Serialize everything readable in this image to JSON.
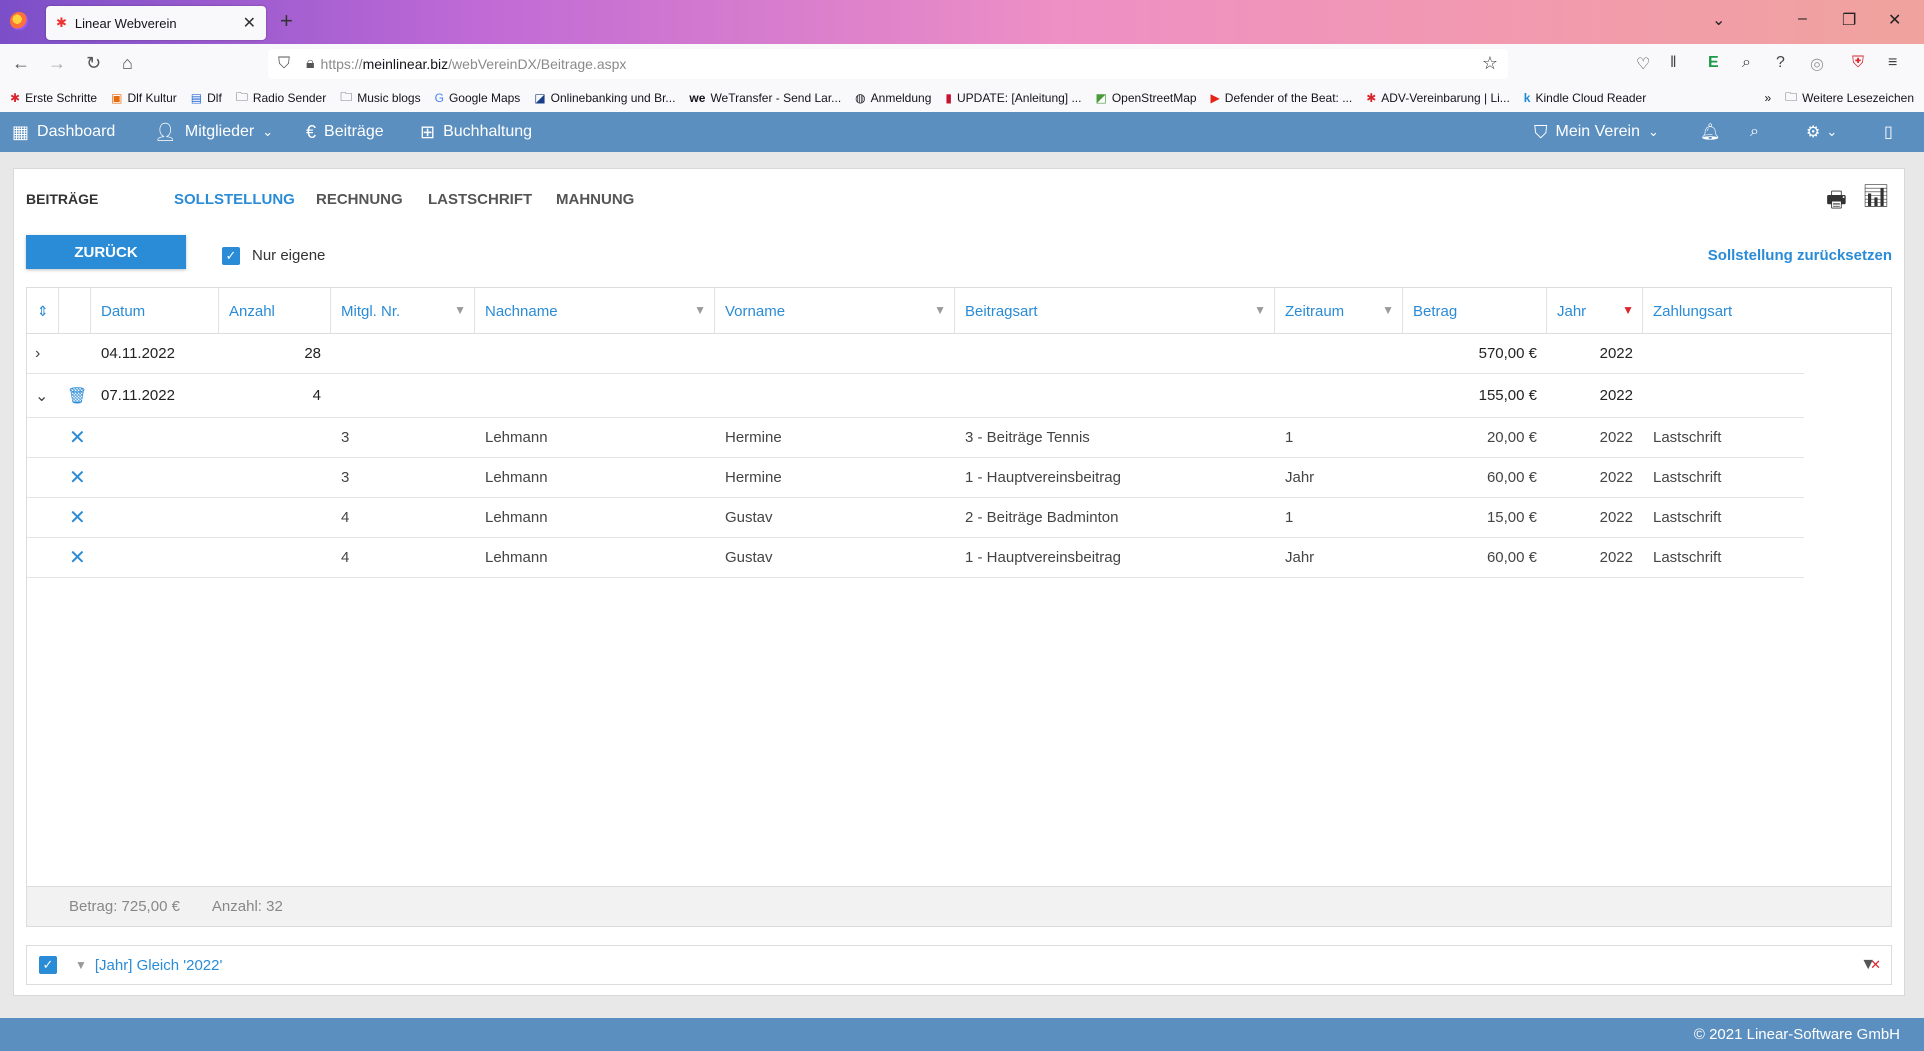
{
  "browser": {
    "tab_title": "Linear Webverein",
    "url_prefix": "https://",
    "url_host": "meinlinear.biz",
    "url_path": "/webVereinDX/Beitrage.aspx",
    "bookmarks": [
      "Erste Schritte",
      "Dlf Kultur",
      "Dlf",
      "Radio Sender",
      "Music blogs",
      "Google Maps",
      "Onlinebanking und Br...",
      "WeTransfer - Send Lar...",
      "Anmeldung",
      "UPDATE: [Anleitung] ...",
      "OpenStreetMap",
      "Defender of the Beat: ...",
      "ADV-Vereinbarung | Li...",
      "Kindle Cloud Reader"
    ],
    "bookmarks_more": "Weitere Lesezeichen"
  },
  "header": {
    "dashboard": "Dashboard",
    "mitglieder": "Mitglieder",
    "beitraege": "Beiträge",
    "buchhaltung": "Buchhaltung",
    "verein": "Mein Verein"
  },
  "page": {
    "title": "BEITRÄGE",
    "tabs": [
      "SOLLSTELLUNG",
      "RECHNUNG",
      "LASTSCHRIFT",
      "MAHNUNG"
    ],
    "back_button": "ZURÜCK",
    "own_only_label": "Nur eigene",
    "reset_link": "Sollstellung zurücksetzen"
  },
  "grid": {
    "columns": [
      "Datum",
      "Anzahl",
      "Mitgl. Nr.",
      "Nachname",
      "Vorname",
      "Beitragsart",
      "Zeitraum",
      "Betrag",
      "Jahr",
      "Zahlungsart"
    ],
    "groups": [
      {
        "datum": "04.11.2022",
        "anzahl": "28",
        "betrag": "570,00 €",
        "jahr": "2022"
      },
      {
        "datum": "07.11.2022",
        "anzahl": "4",
        "betrag": "155,00 €",
        "jahr": "2022"
      }
    ],
    "rows": [
      {
        "nr": "3",
        "nachname": "Lehmann",
        "vorname": "Hermine",
        "beitragsart": "3 - Beiträge Tennis",
        "zeitraum": "1",
        "betrag": "20,00 €",
        "jahr": "2022",
        "zahlungsart": "Lastschrift"
      },
      {
        "nr": "3",
        "nachname": "Lehmann",
        "vorname": "Hermine",
        "beitragsart": "1 - Hauptvereinsbeitrag",
        "zeitraum": "Jahr",
        "betrag": "60,00 €",
        "jahr": "2022",
        "zahlungsart": "Lastschrift"
      },
      {
        "nr": "4",
        "nachname": "Lehmann",
        "vorname": "Gustav",
        "beitragsart": "2 - Beiträge Badminton",
        "zeitraum": "1",
        "betrag": "15,00 €",
        "jahr": "2022",
        "zahlungsart": "Lastschrift"
      },
      {
        "nr": "4",
        "nachname": "Lehmann",
        "vorname": "Gustav",
        "beitragsart": "1 - Hauptvereinsbeitrag",
        "zeitraum": "Jahr",
        "betrag": "60,00 €",
        "jahr": "2022",
        "zahlungsart": "Lastschrift"
      }
    ],
    "footer_betrag": "Betrag: 725,00 €",
    "footer_anzahl": "Anzahl: 32"
  },
  "filter": {
    "text": "[Jahr] Gleich '2022'"
  },
  "footer": {
    "copyright": "© 2021 Linear-Software GmbH"
  },
  "colors": {
    "brand": "#5b8fc0",
    "accent": "#2a8bd6",
    "filter_active": "#d9262e"
  }
}
